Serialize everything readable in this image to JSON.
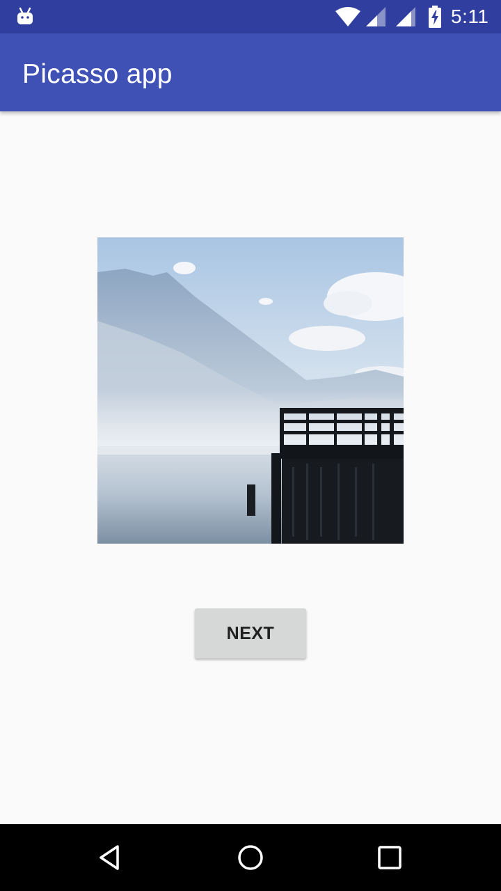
{
  "status_bar": {
    "time": "5:11",
    "icons": [
      "android-icon",
      "wifi-icon",
      "cell-signal-icon",
      "cell-signal-icon",
      "battery-charging-icon"
    ],
    "color": "#303f9f"
  },
  "app_bar": {
    "title": "Picasso app",
    "color": "#3f51b5"
  },
  "main": {
    "image": {
      "subject": "lake with mountains and wooden pier"
    },
    "next_button": {
      "label": "NEXT"
    }
  },
  "nav_bar": {
    "icons": [
      "back-icon",
      "home-icon",
      "recents-icon"
    ]
  }
}
